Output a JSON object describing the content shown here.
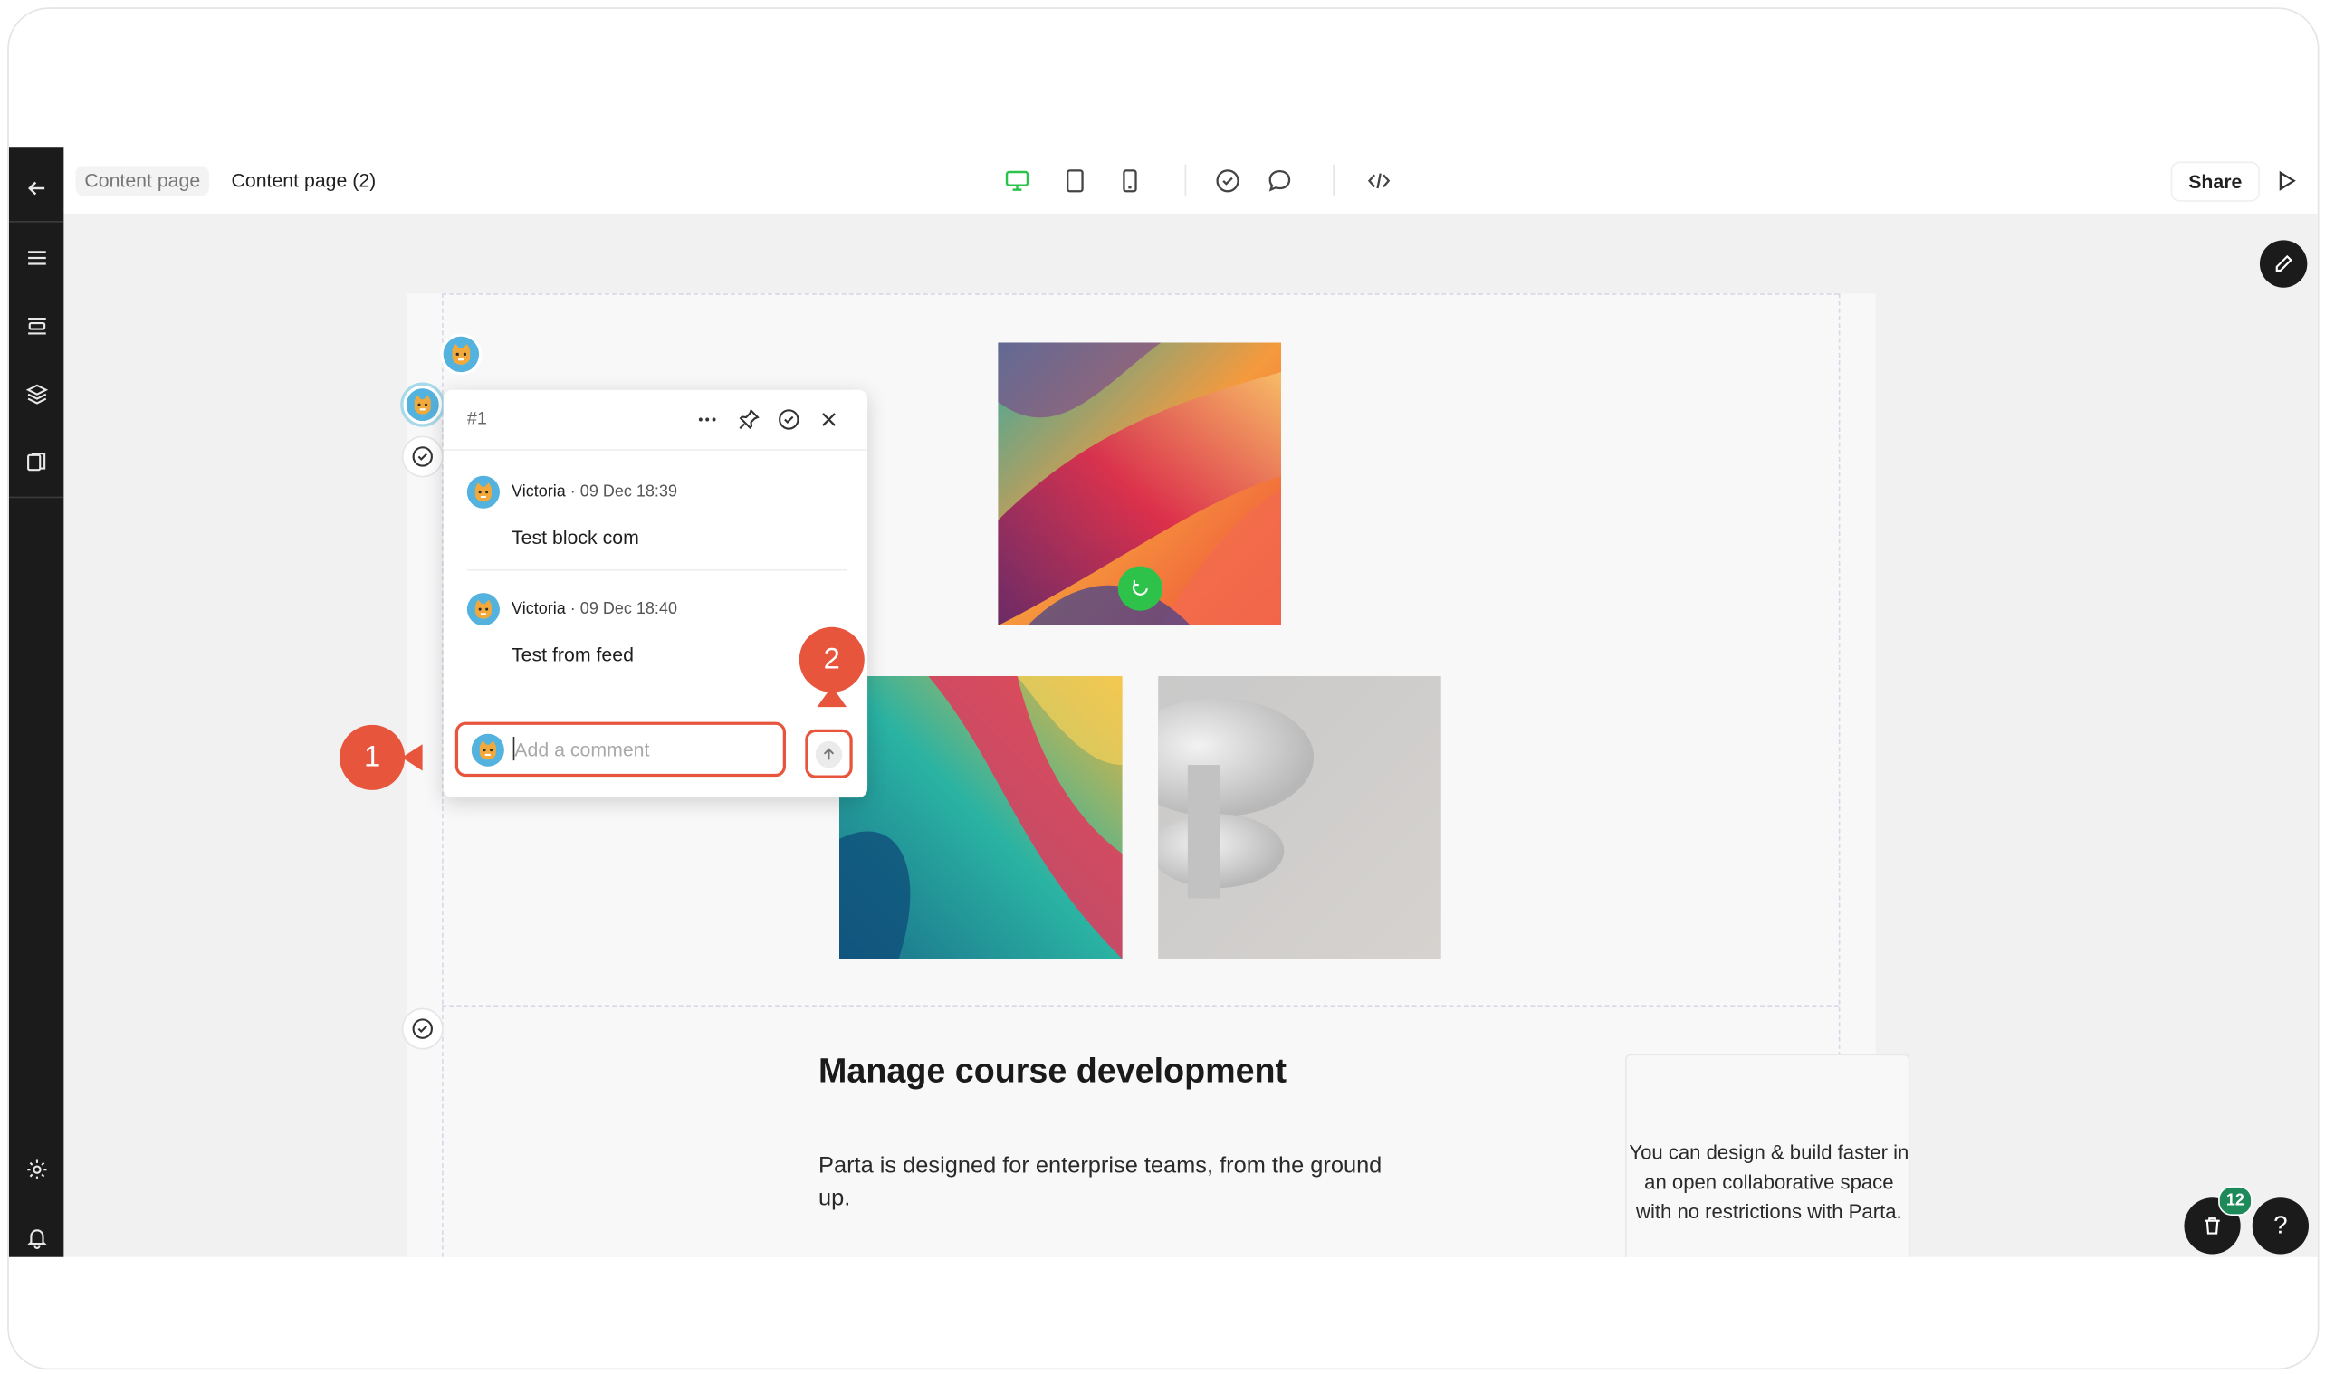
{
  "breadcrumbs": {
    "parent": "Content page",
    "current": "Content page (2)"
  },
  "toolbar": {
    "share_label": "Share"
  },
  "comment_thread": {
    "number": "#1",
    "messages": [
      {
        "author": "Victoria",
        "time": "· 09 Dec 18:39",
        "text": "Test block com"
      },
      {
        "author": "Victoria",
        "time": "· 09 Dec 18:40",
        "text": "Test from feed"
      }
    ],
    "input_placeholder": "Add a comment"
  },
  "content": {
    "heading": "Manage course development",
    "paragraph": "Parta is designed for enterprise teams, from the ground up.",
    "card_text": "You can design & build faster in an open collaborative space with no restrictions with Parta."
  },
  "callouts": {
    "one": "1",
    "two": "2"
  },
  "badge_count": "12",
  "help_label": "?",
  "colors": {
    "accent": "#e8553d",
    "sidebar": "#1b1b1b",
    "active_device": "#2ec24a",
    "badge": "#1e8a5a"
  },
  "icons": [
    "back-arrow-icon",
    "menu-icon",
    "sections-icon",
    "layers-icon",
    "pages-icon",
    "settings-icon",
    "bell-icon",
    "desktop-icon",
    "tablet-icon",
    "mobile-icon",
    "check-circle-icon",
    "comment-icon",
    "code-icon",
    "play-icon",
    "pencil-icon",
    "trash-icon",
    "more-icon",
    "pin-icon",
    "close-icon",
    "send-arrow-icon",
    "avatar-icon"
  ]
}
